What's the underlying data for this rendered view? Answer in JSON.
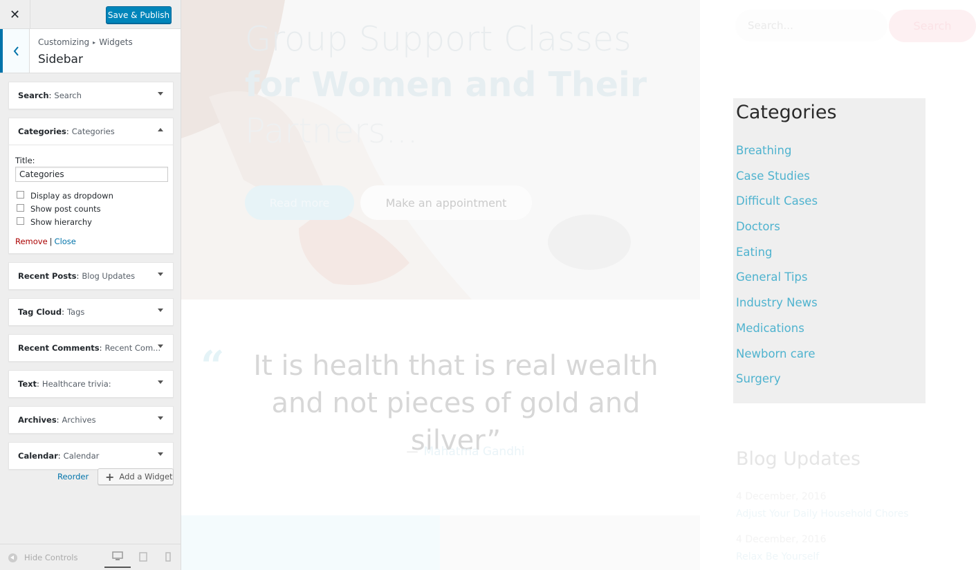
{
  "panel": {
    "close_icon": "close-icon",
    "publish_label": "Save & Publish",
    "breadcrumb": [
      "Customizing",
      "Widgets"
    ],
    "section_title": "Sidebar",
    "widgets": [
      {
        "type": "Search",
        "name": "Search"
      },
      {
        "type": "Categories",
        "name": "Categories"
      },
      {
        "type": "Recent Posts",
        "name": "Blog Updates"
      },
      {
        "type": "Tag Cloud",
        "name": "Tags"
      },
      {
        "type": "Recent Comments",
        "name": "Recent Com..."
      },
      {
        "type": "Text",
        "name": "Healthcare trivia:"
      },
      {
        "type": "Archives",
        "name": "Archives"
      },
      {
        "type": "Calendar",
        "name": "Calendar"
      }
    ],
    "open_widget": {
      "title_label": "Title:",
      "title_value": "Categories",
      "checkboxes": [
        "Display as dropdown",
        "Show post counts",
        "Show hierarchy"
      ],
      "remove_label": "Remove",
      "separator": "|",
      "close_label": "Close"
    },
    "reorder_label": "Reorder",
    "add_widget_label": "Add a Widget",
    "hide_controls_label": "Hide Controls"
  },
  "preview": {
    "hero": {
      "line1": "Group Support Classes",
      "line2": "for Women and Their",
      "line3": "Partners...",
      "read_more": "Read more",
      "appointment": "Make an appointment"
    },
    "quote": {
      "text": "It is health that is real wealth and not pieces of gold and silver”",
      "dash": "—",
      "author": "Mahatma Gandhi"
    },
    "search": {
      "placeholder": "Search...",
      "button": "Search"
    },
    "categories": {
      "title": "Categories",
      "items": [
        "Breathing",
        "Case Studies",
        "Difficult Cases",
        "Doctors",
        "Eating",
        "General Tips",
        "Industry News",
        "Medications",
        "Newborn care",
        "Surgery"
      ]
    },
    "blog": {
      "title": "Blog Updates",
      "posts": [
        {
          "date": "4 December, 2016",
          "title": "Adjust Your Daily Household Chores"
        },
        {
          "date": "4 December, 2016",
          "title": "Relax Be Yourself"
        }
      ]
    }
  },
  "colors": {
    "accent": "#0085ba",
    "link": "#0073aa",
    "remove": "#aa0000",
    "category_link": "#4fb3cf"
  }
}
